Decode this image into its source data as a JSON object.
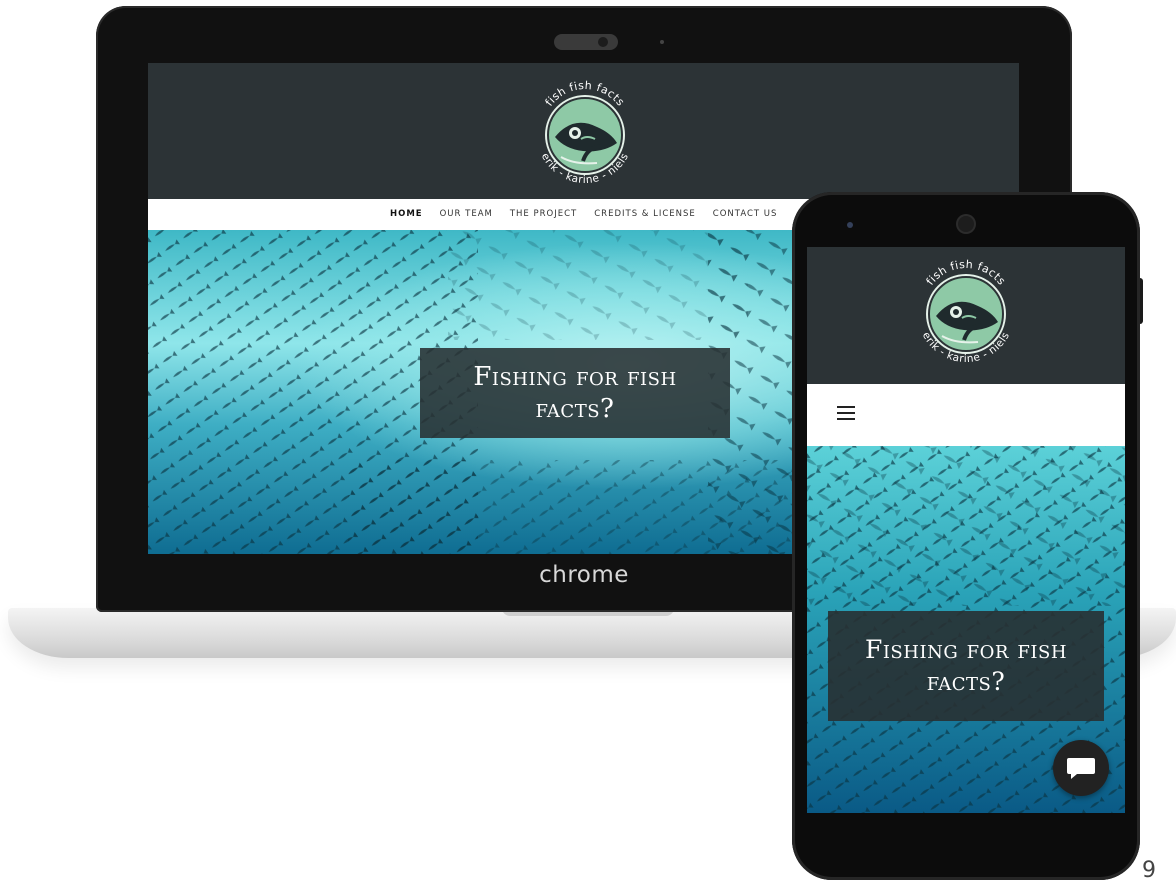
{
  "logo": {
    "top_text": "fish fish facts",
    "bottom_text": "erik - karine - niels"
  },
  "nav": {
    "items": [
      {
        "label": "HOME",
        "active": true
      },
      {
        "label": "OUR TEAM",
        "active": false
      },
      {
        "label": "THE PROJECT",
        "active": false
      },
      {
        "label": "CREDITS & LICENSE",
        "active": false
      },
      {
        "label": "CONTACT US",
        "active": false
      }
    ]
  },
  "hero": {
    "heading": "Fishing for fish facts?"
  },
  "device": {
    "laptop_brand": "chrome"
  },
  "page_number": "9",
  "icons": {
    "menu": "hamburger-menu-icon",
    "chat": "chat-bubble-icon",
    "logo": "fish-logo-icon"
  },
  "colors": {
    "header_bg": "#2c3336",
    "logo_green": "#8ec9a6",
    "water_light": "#7fe0e6",
    "water_deep": "#0b5b86",
    "card_bg": "#283032"
  }
}
